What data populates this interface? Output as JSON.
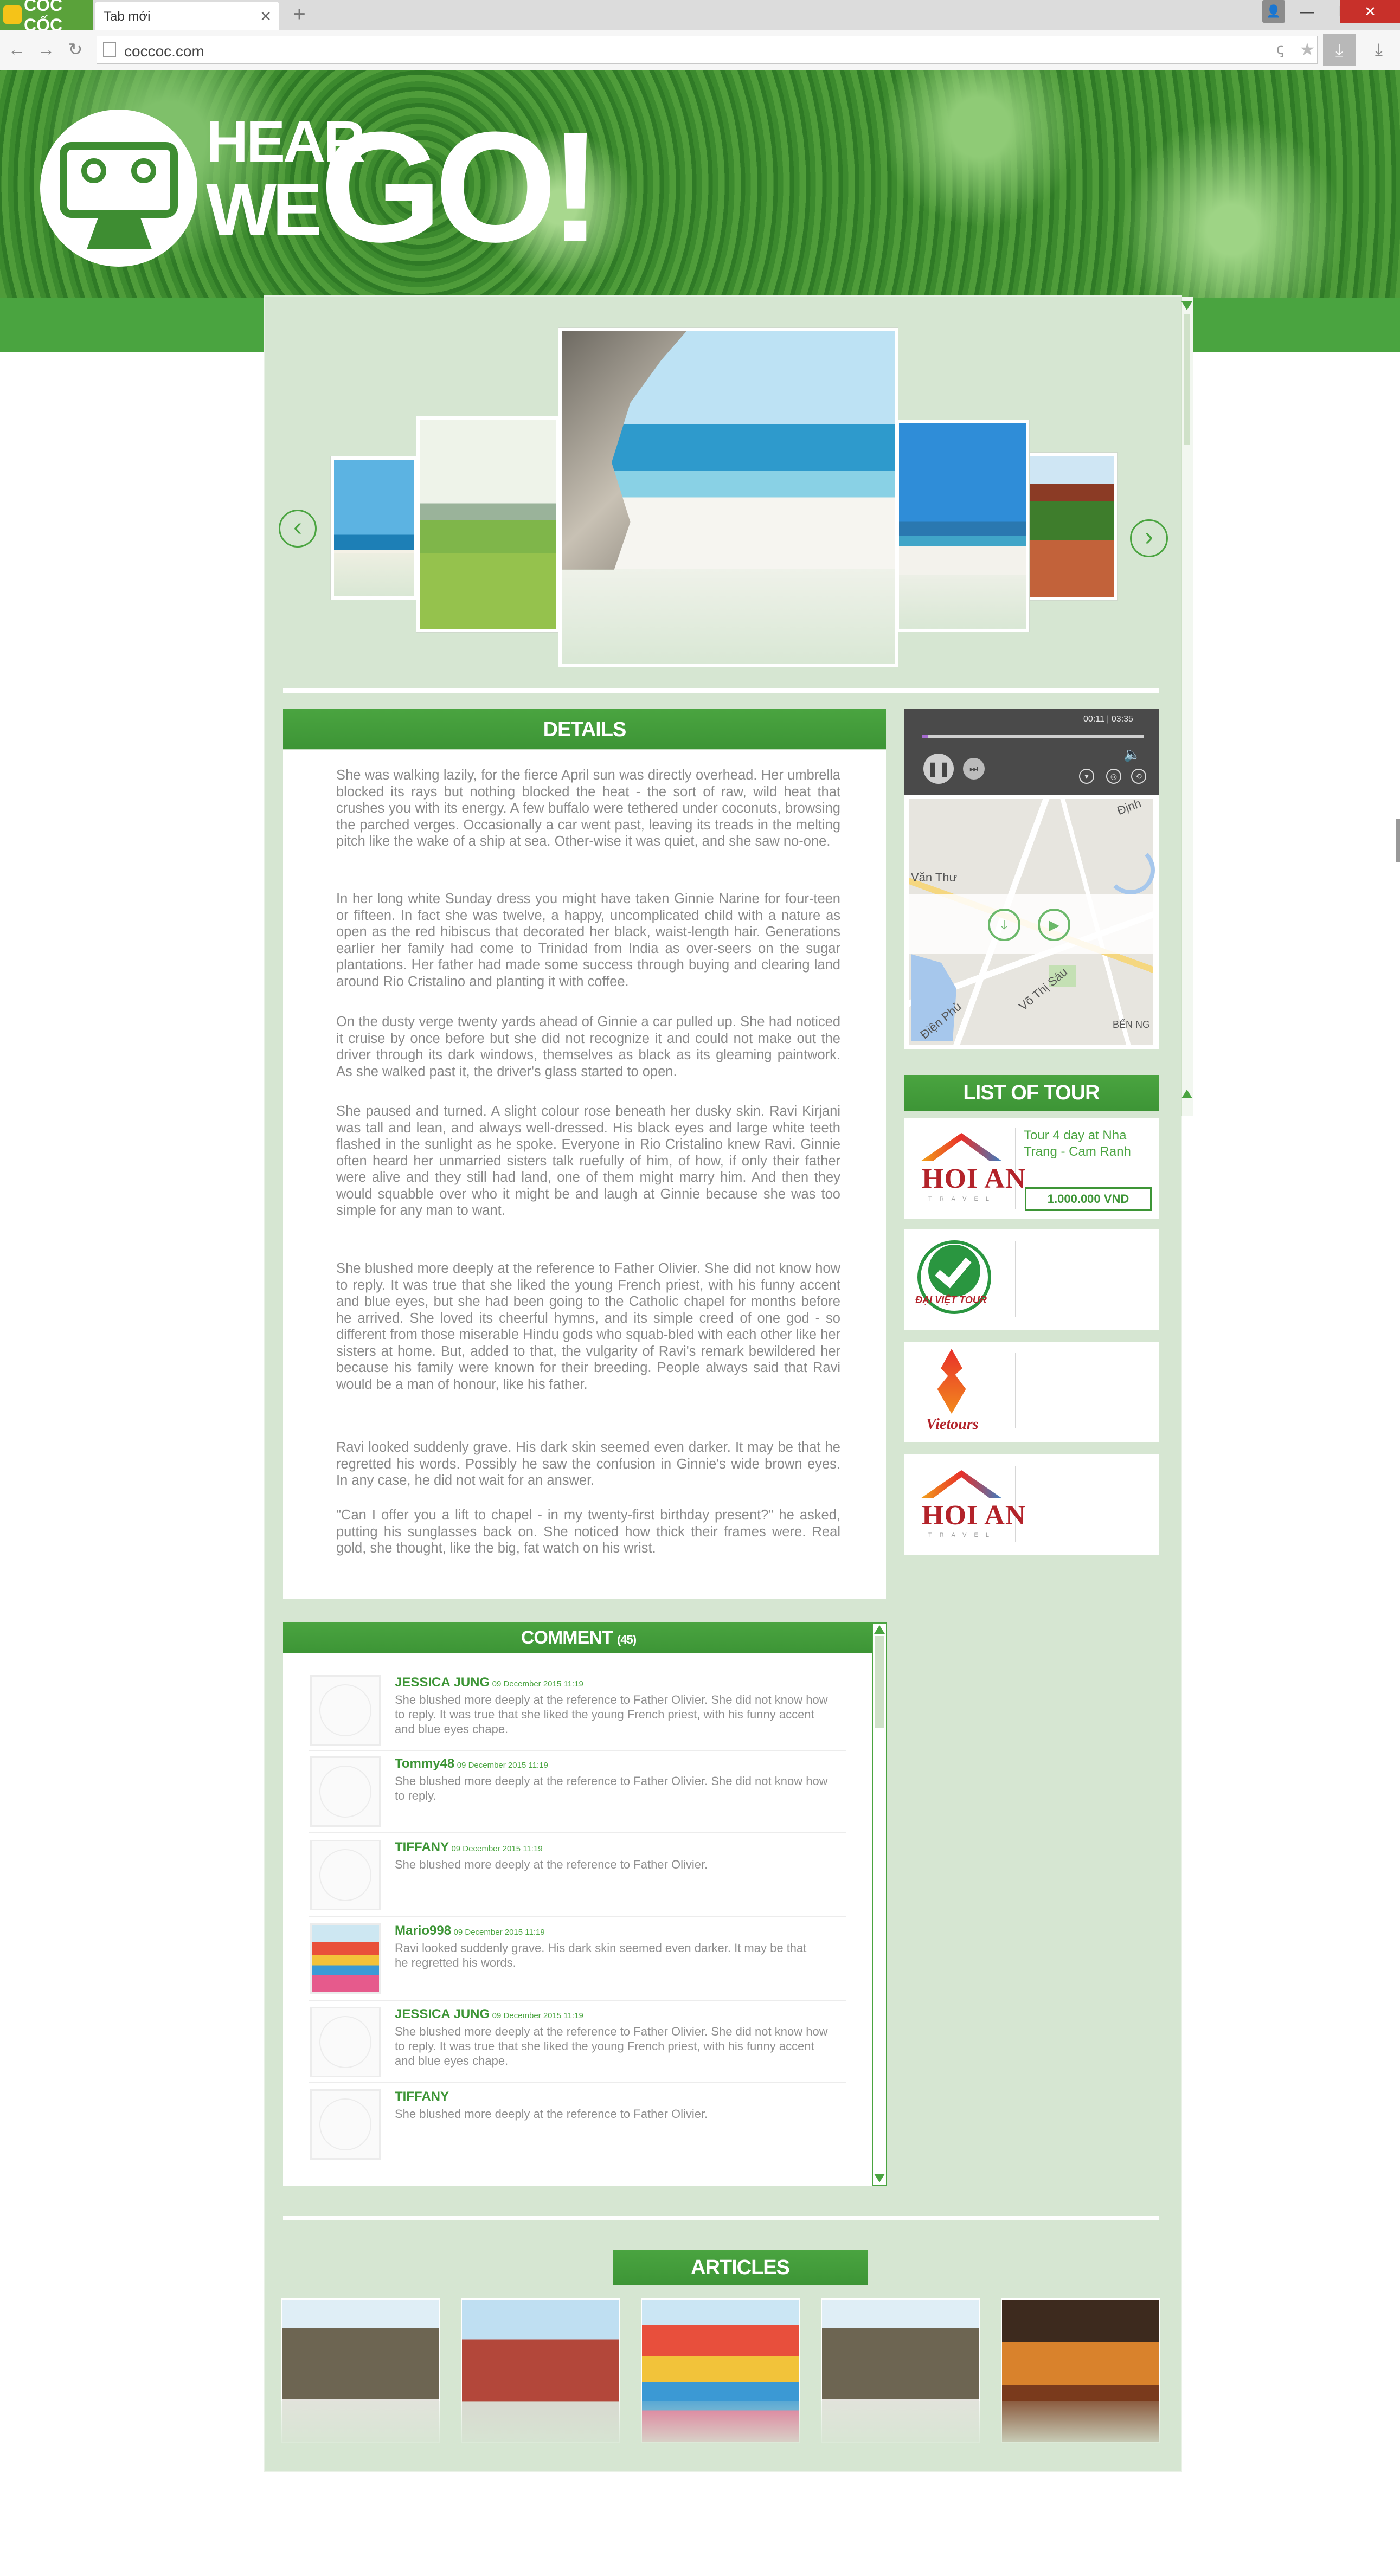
{
  "browser": {
    "brand": "CỐC CỐC",
    "tab_title": "Tab mới",
    "tab_close": "✕",
    "new_tab": "+",
    "url": "coccoc.com",
    "back": "←",
    "forward": "→",
    "reload": "↻",
    "download": "⤓",
    "win_min": "—",
    "win_max": "❐",
    "win_close": "✕",
    "user": "👤"
  },
  "logo": {
    "line1": "HEAR",
    "line2": "WE",
    "line3": "GO!"
  },
  "carousel": {
    "prev": "‹",
    "next": "›"
  },
  "details": {
    "heading": "DETAILS",
    "paragraphs": [
      "She was walking lazily, for the fierce April sun was directly overhead. Her umbrella blocked its rays but nothing blocked the heat - the sort of raw, wild heat that crushes you with its energy. A few buffalo were tethered under coconuts, browsing the parched verges. Occasionally a car went past, leaving its treads in the melting pitch like the wake of a ship at sea. Other-wise it was quiet, and she saw no-one.",
      "In her long white Sunday dress you might have taken Ginnie Narine for four-teen or fifteen. In fact she was twelve, a happy, uncomplicated child with a nature as open as the red hibiscus that decorated her black, waist-length hair. Generations earlier her family had come to Trinidad from India as over-seers on the sugar plantations. Her father had made some success through buying and clearing land around Rio Cristalino and planting it with coffee.",
      "On the dusty verge twenty yards ahead of Ginnie a car pulled up. She had noticed it cruise by once before but she did not recognize it and could not make out the driver through its dark windows, themselves as black as its gleaming paintwork. As she walked past it, the driver's glass started to open.",
      "She paused and turned. A slight colour rose beneath her dusky skin. Ravi Kirjani was tall and lean, and always well-dressed. His black eyes and large white teeth flashed in the sunlight as he spoke. Everyone in Rio Cristalino knew Ravi. Ginnie often heard her unmarried sisters talk ruefully of him, of how, if only their father were alive and they still had land, one of them might marry him. And then they would squabble over who it might be and laugh at Ginnie because she was too simple for any man to want.",
      "She blushed more deeply at the reference to Father Olivier. She did not know how to reply. It was true that she liked the young French priest, with his funny accent and blue eyes, but she had been going to the Catholic chapel for months before he arrived. She loved its cheerful hymns, and its simple creed of one god - so different from those miserable Hindu gods who squab-bled with each other like her sisters at home. But, added to that, the vulgarity of Ravi's remark bewildered her because his family were known for their breeding. People always said that Ravi would be a man of honour, like his father.",
      "Ravi looked suddenly grave. His dark skin seemed even darker. It may be that he regretted his words. Possibly he saw the confusion in Ginnie's wide brown eyes. In any case, he did not wait for an answer.",
      "\"Can I offer you a lift to chapel - in my twenty-first birthday present?\" he asked, putting his sunglasses back on. She noticed how thick their frames were. Real gold, she thought, like the big, fat watch on his wrist."
    ]
  },
  "player": {
    "time": "00:11 | 03:35",
    "progress": 0.03,
    "pause": "❚❚",
    "next": "⏭",
    "volume": "🔈",
    "ctl1": "▾",
    "ctl2": "◎",
    "ctl3": "⟲"
  },
  "map": {
    "label1": "Văn Thư",
    "label2": "Võ Thị Sáu",
    "label3": "Điện Phủ",
    "label4": "BẾN NG",
    "label5": "Định",
    "download": "⤓",
    "play": "▶"
  },
  "tours": {
    "heading": "LIST OF TOUR",
    "featured_title": "Tour 4 day at Nha Trang - Cam Ranh",
    "featured_price": "1.000.000 VND",
    "hoian": "HOI AN",
    "hoian_sub": "TRAVEL",
    "dvt": "ĐẠI VIỆT TOUR",
    "vt": "Vietours",
    "colors": {
      "accent": "#4aa440",
      "brand_red": "#b3232a"
    }
  },
  "comments": {
    "heading": "COMMENT",
    "count": "(45)",
    "items": [
      {
        "name": "JESSICA JUNG",
        "date": "09 December 2015  11:19",
        "text": "She blushed more deeply at the reference to Father Olivier. She did not know how to reply. It was true that she liked the young French priest, with his funny accent and blue eyes chape."
      },
      {
        "name": "Tommy48",
        "date": "09 December 2015  11:19",
        "text": "She blushed more deeply at the reference to Father Olivier. She did not know how to reply."
      },
      {
        "name": "TIFFANY",
        "date": "09 December 2015  11:19",
        "text": "She blushed more deeply at the reference to Father Olivier."
      },
      {
        "name": "Mario998",
        "date": "09 December 2015  11:19",
        "text": "Ravi looked suddenly grave. His dark skin seemed even darker. It may be that he regretted his words."
      },
      {
        "name": "JESSICA JUNG",
        "date": "09 December 2015  11:19",
        "text": "She blushed more deeply at the reference to Father Olivier. She did not know how to reply. It was true that she liked the young French priest, with his funny accent and blue eyes chape."
      },
      {
        "name": "TIFFANY",
        "date": "",
        "text": "She blushed more deeply at the reference to Father Olivier."
      }
    ]
  },
  "articles": {
    "heading": "ARTICLES"
  }
}
